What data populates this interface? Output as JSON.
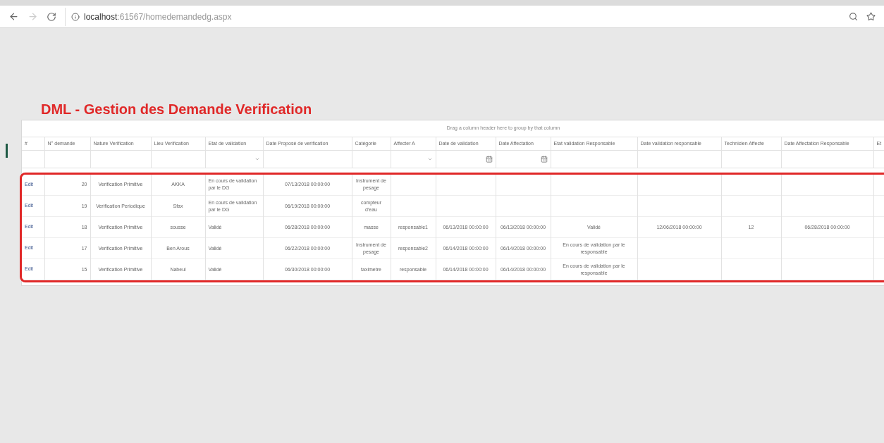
{
  "browser": {
    "url_host": "localhost",
    "url_path": ":61567/homedemandedg.aspx",
    "forward_disabled": true
  },
  "title": "DML - Gestion des Demande Verification",
  "group_panel": "Drag a column header here to group by that column",
  "columns": [
    {
      "label": "#",
      "kind": "none"
    },
    {
      "label": "N° demande",
      "kind": "text"
    },
    {
      "label": "Nature Verification",
      "kind": "text"
    },
    {
      "label": "Lieu Verification",
      "kind": "text"
    },
    {
      "label": "Etat de validation",
      "kind": "dropdown"
    },
    {
      "label": "Date Proposé de verification",
      "kind": "text"
    },
    {
      "label": "Catégorie",
      "kind": "text"
    },
    {
      "label": "Affecter A",
      "kind": "dropdown"
    },
    {
      "label": "Date de validation",
      "kind": "date"
    },
    {
      "label": "Date Affectation",
      "kind": "date"
    },
    {
      "label": "Etat validation Responsable",
      "kind": "text"
    },
    {
      "label": "Date validation responsable",
      "kind": "text"
    },
    {
      "label": "Technicien Affecte",
      "kind": "text"
    },
    {
      "label": "Date Affectation Responsable",
      "kind": "text"
    },
    {
      "label": "Et",
      "kind": "text"
    }
  ],
  "rows": [
    {
      "edit": "Edit",
      "cells": [
        "20",
        "Verification Primitive",
        "AKKA",
        "En cours de validation par le DG",
        "07/13/2018 00:00:00",
        "Instrument de pesage",
        "",
        "",
        "",
        "",
        "",
        "",
        "",
        ""
      ]
    },
    {
      "edit": "Edit",
      "cells": [
        "19",
        "Verification Periodique",
        "Sfax",
        "En cours de validation par le DG",
        "06/19/2018 00:00:00",
        "compteur d'eau",
        "",
        "",
        "",
        "",
        "",
        "",
        "",
        ""
      ]
    },
    {
      "edit": "Edit",
      "cells": [
        "18",
        "Verification Primitive",
        "sousse",
        "Validé",
        "06/28/2018 00:00:00",
        "masse",
        "responsable1",
        "06/13/2018 00:00:00",
        "06/13/2018 00:00:00",
        "Validé",
        "12/06/2018 00:00:00",
        "12",
        "06/28/2018 00:00:00",
        ""
      ]
    },
    {
      "edit": "Edit",
      "cells": [
        "17",
        "Verification Primitive",
        "Ben Arous",
        "Validé",
        "06/22/2018 00:00:00",
        "Instrument de pesage",
        "responsable2",
        "06/14/2018 00:00:00",
        "06/14/2018 00:00:00",
        "En cours de validation par le responsable",
        "",
        "",
        "",
        ""
      ]
    },
    {
      "edit": "Edit",
      "cells": [
        "15",
        "Verification Primitive",
        "Nabeul",
        "Validé",
        "06/30/2018 00:00:00",
        "taximetre",
        "responsable",
        "06/14/2018 00:00:00",
        "06/14/2018 00:00:00",
        "En cours de validation par le responsable",
        "",
        "",
        "",
        ""
      ]
    }
  ]
}
